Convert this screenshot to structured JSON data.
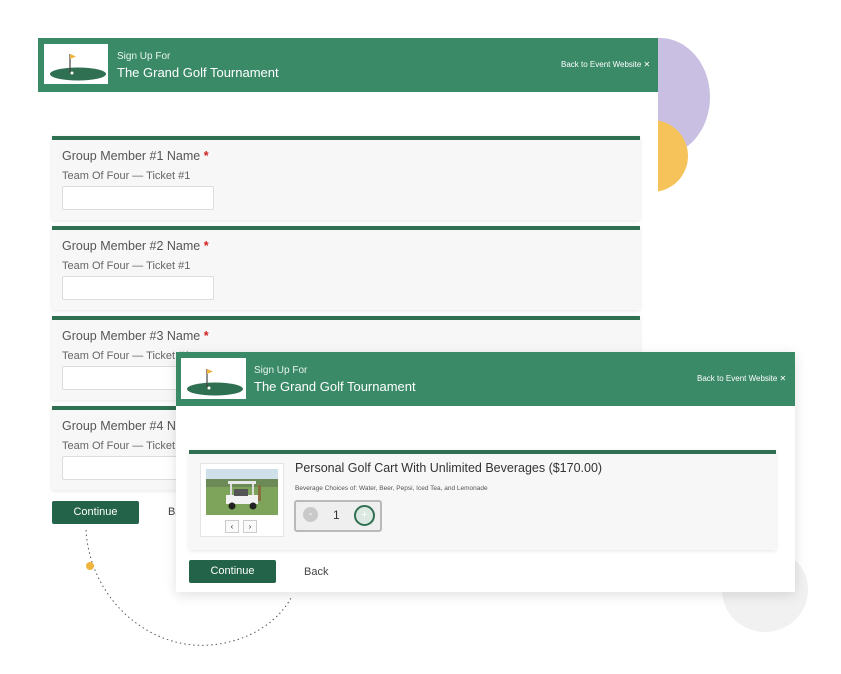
{
  "event": {
    "signup_label": "Sign Up For",
    "name": "The Grand Golf Tournament",
    "back_link": "Back to Event Website ✕"
  },
  "group_members": [
    {
      "label": "Group Member #1 Name",
      "required_mark": "*",
      "ticket": "Team Of Four — Ticket #1",
      "value": ""
    },
    {
      "label": "Group Member #2 Name",
      "required_mark": "*",
      "ticket": "Team Of Four — Ticket #1",
      "value": ""
    },
    {
      "label": "Group Member #3 Name",
      "required_mark": "*",
      "ticket": "Team Of Four — Ticket #1",
      "value": ""
    },
    {
      "label": "Group Member #4 Name",
      "required_mark": "*",
      "ticket": "Team Of Four — Ticket #1",
      "value": ""
    }
  ],
  "back_form": {
    "continue_label": "Continue",
    "back_label": "Back"
  },
  "product": {
    "title": "Personal Golf Cart With Unlimited Beverages ($170.00)",
    "description": "Beverage Choices of: Water, Beer, Pepsi, Iced Tea, and Lemonade",
    "prev_label": "‹",
    "next_label": "›",
    "quantity": "1",
    "minus_label": "-",
    "plus_label": "+"
  },
  "front_form": {
    "continue_label": "Continue",
    "back_label": "Back"
  },
  "colors": {
    "header_green": "#3a8a68",
    "button_green": "#236349",
    "required_red": "#d02020"
  }
}
